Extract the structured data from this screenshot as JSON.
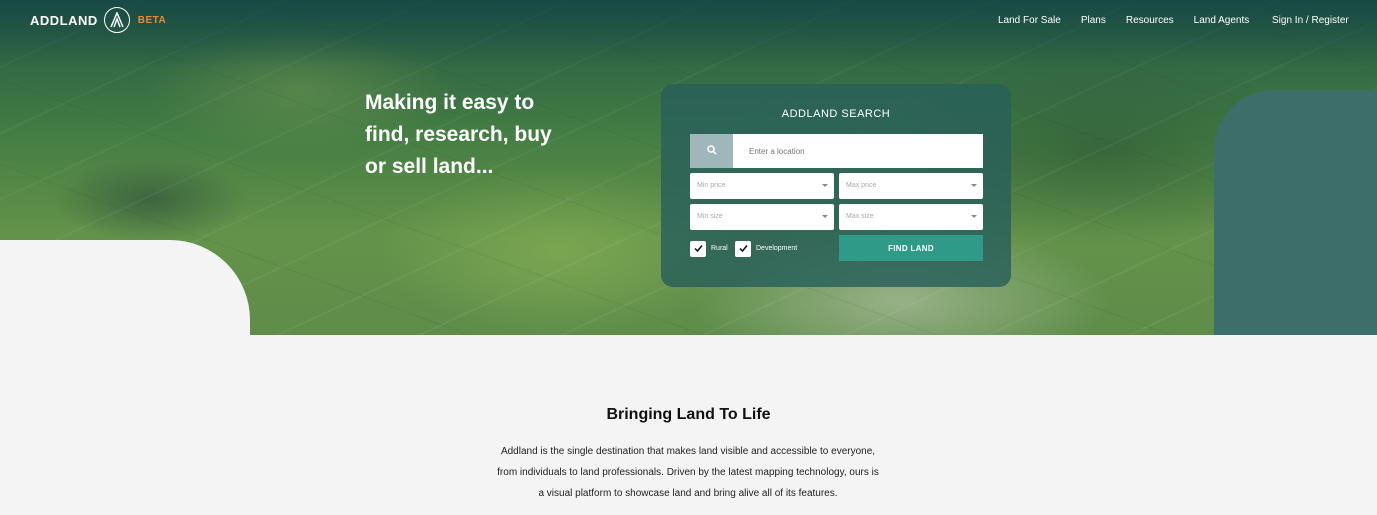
{
  "nav": {
    "logo_text": "ADDLAND",
    "logo_badge": "BETA",
    "links": [
      "Land For Sale",
      "Plans",
      "Resources",
      "Land Agents"
    ],
    "signin": "Sign In / Register"
  },
  "hero": {
    "headline_lines": [
      "Making it easy to",
      "find, research, buy",
      "or sell land..."
    ]
  },
  "search": {
    "title": "ADDLAND SEARCH",
    "location_placeholder": "Enter a location",
    "min_price": "Min price",
    "max_price": "Max price",
    "min_size": "Min size",
    "max_size": "Max size",
    "checkbox_rural": "Rural",
    "checkbox_development": "Development",
    "find_button": "FIND LAND"
  },
  "about": {
    "title": "Bringing Land To Life",
    "lines": [
      "Addland is the single destination that makes land visible and accessible to everyone,",
      "from individuals to land professionals. Driven by the latest mapping technology, ours is",
      "a visual platform to showcase land and bring alive all of its features."
    ]
  },
  "colors": {
    "accent_orange": "#e58a3a",
    "teal_button": "#2f9a88",
    "panel_teal": "#285f5a"
  }
}
